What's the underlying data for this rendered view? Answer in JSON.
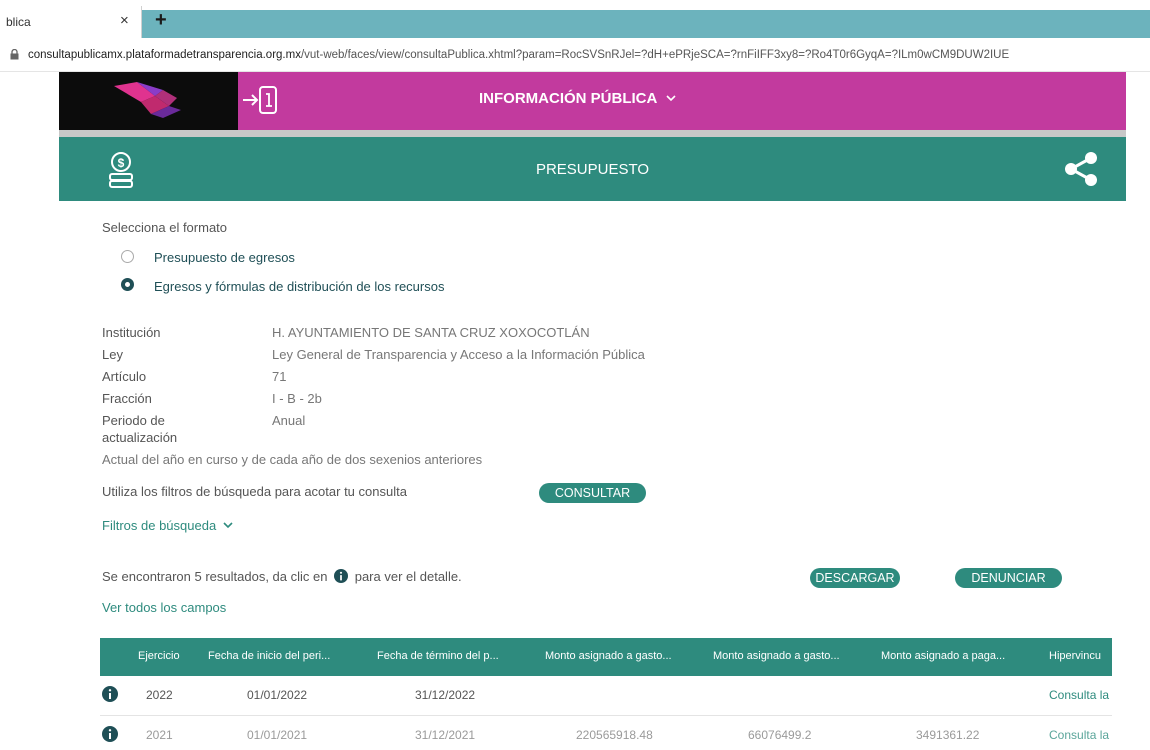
{
  "browser": {
    "tab_title": "blica",
    "tab_close": "×",
    "new_tab": "+",
    "url_domain": "consultapublicamx.plataformadetransparencia.org.mx",
    "url_path": "/vut-web/faces/view/consultaPublica.xhtml?param=RocSVSnRJel=?dH+ePRjeSCA=?rnFiIFF3xy8=?Ro4T0r6GyqA=?ILm0wCM9DUW2IUE"
  },
  "header": {
    "menu_label": "INFORMACIÓN PÚBLICA",
    "section_title": "PRESUPUESTO"
  },
  "format": {
    "prompt": "Selecciona el formato",
    "options": [
      {
        "label": "Presupuesto de egresos",
        "selected": false
      },
      {
        "label": "Egresos y fórmulas de distribución de los recursos",
        "selected": true
      }
    ]
  },
  "details": {
    "institucion_label": "Institución",
    "institucion_value": "H. AYUNTAMIENTO DE SANTA CRUZ XOXOCOTLÁN",
    "ley_label": "Ley",
    "ley_value": "Ley General de Transparencia y Acceso a la Información Pública",
    "articulo_label": "Artículo",
    "articulo_value": "71",
    "fraccion_label": "Fracción",
    "fraccion_value": "I - B - 2b",
    "periodo_label_1": "Periodo de",
    "periodo_label_2": "actualización",
    "periodo_value": "Anual",
    "note": "Actual del año en curso y de cada año de dos sexenios anteriores"
  },
  "filters": {
    "hint": "Utiliza los filtros de búsqueda para acotar tu consulta",
    "consultar": "CONSULTAR",
    "toggle_label": "Filtros de búsqueda"
  },
  "results": {
    "text_before": "Se encontraron 5 resultados, da clic en",
    "text_after": "para ver el detalle.",
    "download": "DESCARGAR",
    "report": "DENUNCIAR",
    "view_all": "Ver todos los campos"
  },
  "table": {
    "headers": [
      "Ejercicio",
      "Fecha de inicio del peri...",
      "Fecha de término del p...",
      "Monto asignado a gasto...",
      "Monto asignado a gasto...",
      "Monto asignado a paga...",
      "Hipervincu"
    ],
    "rows": [
      {
        "ejercicio": "2022",
        "inicio": "01/01/2022",
        "termino": "31/12/2022",
        "m1": "",
        "m2": "",
        "m3": "",
        "link": "Consulta la"
      },
      {
        "ejercicio": "2021",
        "inicio": "01/01/2021",
        "termino": "31/12/2021",
        "m1": "220565918.48",
        "m2": "66076499.2",
        "m3": "3491361.22",
        "link": "Consulta la"
      }
    ]
  },
  "colors": {
    "teal": "#2e8b7e",
    "magenta": "#c23a9e",
    "tabstrip": "#6cb3bd"
  }
}
